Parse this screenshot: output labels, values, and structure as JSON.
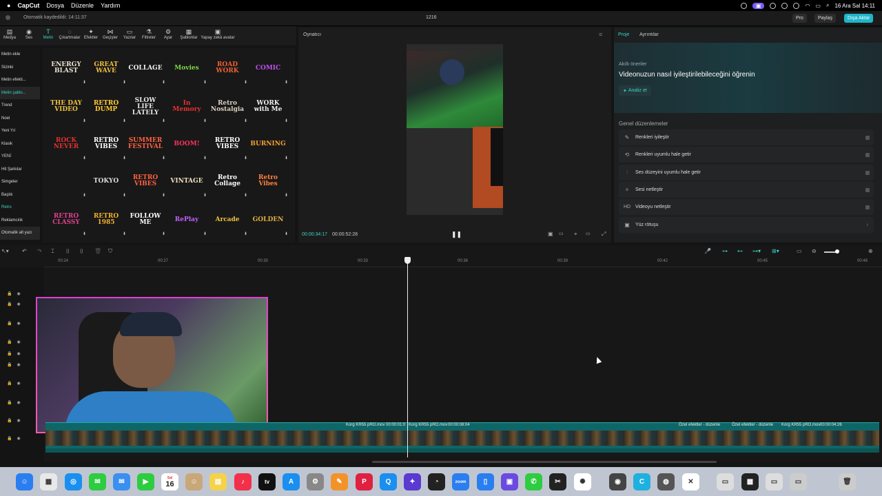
{
  "menubar": {
    "app": "CapCut",
    "items": [
      "Dosya",
      "Düzenle",
      "Yardım"
    ],
    "clock": "16 Ara Sal 14:11"
  },
  "titlebar": {
    "autosave": "Otomatik kaydedildi: 14:11:37",
    "project": "1216",
    "pro": "Pro",
    "share": "Paylaş",
    "export": "Dışa Aktar"
  },
  "toolbar": {
    "items": [
      {
        "label": "Medya",
        "icon": "media-icon"
      },
      {
        "label": "Ses",
        "icon": "audio-icon"
      },
      {
        "label": "Metin",
        "icon": "text-icon"
      },
      {
        "label": "Çıkartmalar",
        "icon": "sticker-icon"
      },
      {
        "label": "Efektler",
        "icon": "effects-icon"
      },
      {
        "label": "Geçişler",
        "icon": "transitions-icon"
      },
      {
        "label": "Yazılar",
        "icon": "captions-icon"
      },
      {
        "label": "Filtreler",
        "icon": "filters-icon"
      },
      {
        "label": "Ayar",
        "icon": "adjust-icon"
      },
      {
        "label": "Şablonlar",
        "icon": "templates-icon"
      },
      {
        "label": "Yapay zekâ avatar",
        "icon": "ai-avatar-icon"
      }
    ]
  },
  "categories": [
    "Metin ekle",
    "Sizinki",
    "Metin efekti...",
    "Metin şablo...",
    "Trend",
    "Noel",
    "Yeni Yıl",
    "Klasik",
    "YENİ",
    "Hit Şarkılar",
    "Simgeler",
    "Başlık",
    "Retro",
    "Reklamcılık",
    "Otomatik alt yazı"
  ],
  "tiles": [
    "ENERGY BLAST",
    "GREAT WAVE",
    "COLLAGE",
    "Movies",
    "ROAD WORK",
    "COMIC",
    "THE DAY VIDEO",
    "RETRO DUMP",
    "SLOW LIFE LATELY",
    "In Memory",
    "Retro Nostalgia",
    "WORK with Me",
    "ROCK NEVER",
    "RETRO VIBES",
    "SUMMER FESTIVAL",
    "BOOM!",
    "RETRO VIBES",
    "BURNING",
    "",
    "TOKYO",
    "RETRO VIBES",
    "VINTAGE",
    "Retro Collage",
    "Retro Vibes",
    "RETRO CLASSY",
    "RETRO 1985",
    "FOLLOW ME",
    "RePlay",
    "Arcade",
    "GOLDEN"
  ],
  "player": {
    "title": "Oynatıcı",
    "current": "00:00:34:17",
    "total": "00:00:52:28"
  },
  "right": {
    "tabs": [
      "Proje",
      "Ayrıntılar"
    ],
    "smart_label": "Akıllı öneriler",
    "smart_title": "Videonuzun nasıl iyileştirilebileceğini öğrenin",
    "analyze": "Analiz et",
    "general": "Genel düzenlemeler",
    "options": [
      {
        "label": "Renkleri iyileştir",
        "icon": "color-enhance-icon"
      },
      {
        "label": "Renkleri uyumlu hale getir",
        "icon": "color-match-icon"
      },
      {
        "label": "Ses düzeyini uyumlu hale getir",
        "icon": "volume-normalize-icon"
      },
      {
        "label": "Sesi netleştir",
        "icon": "voice-enhance-icon"
      },
      {
        "label": "Videoyu netleştir",
        "icon": "hd-icon"
      },
      {
        "label": "Yüz rötuşu",
        "icon": "face-retouch-icon"
      }
    ]
  },
  "timeline": {
    "ticks": [
      "00:24",
      "00:27",
      "00:30",
      "00:33",
      "00:36",
      "00:39",
      "00:42",
      "00:45",
      "00:48"
    ],
    "clip_labels": [
      "Korg KR55 pRO.mov",
      "00:00:01:0",
      "Korg KR55 pRO.mov",
      "00:00:08:04",
      "Özel efektler - düzenle",
      "Özel efektler - düzenle",
      "Korg KR55 pRO.mov",
      "00:00:04:26"
    ]
  },
  "dock": {
    "calendar_day": "16",
    "calendar_month": "Sal",
    "tv": "tv",
    "zoom": "zoom"
  },
  "colors": {
    "accent": "#3bd6c6",
    "export": "#1fb5c9",
    "webcam_border": "#e040d0"
  }
}
